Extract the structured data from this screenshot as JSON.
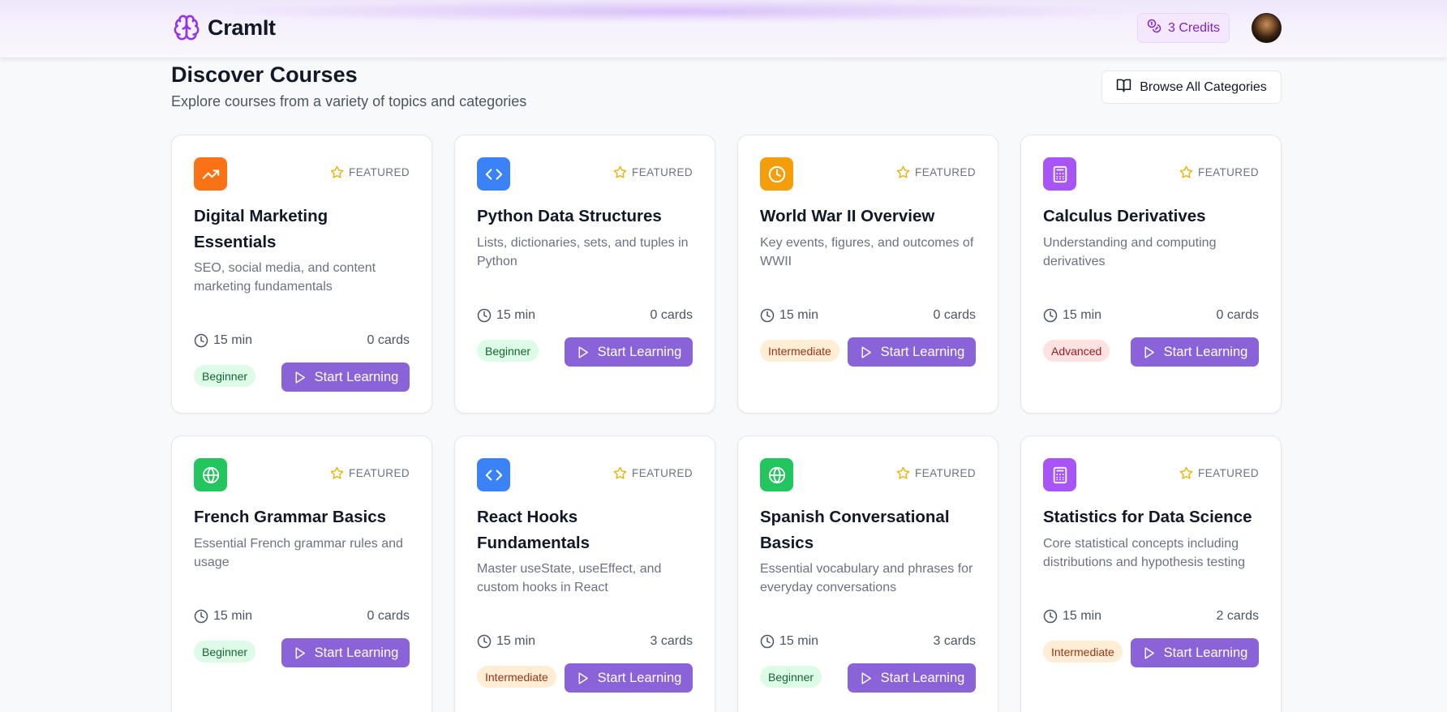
{
  "header": {
    "brand": "CramIt",
    "credits": "3 Credits"
  },
  "page": {
    "title": "Discover Courses",
    "subtitle": "Explore courses from a variety of topics and categories",
    "browse_label": "Browse All Categories"
  },
  "colors": {
    "accent": "#8b63d9",
    "icon_orange_dark": "#f97316",
    "icon_blue": "#3b82f6",
    "icon_amber": "#f59e0b",
    "icon_purple": "#a855f7",
    "icon_green": "#22c55e"
  },
  "courses": [
    {
      "icon": "trending-up-icon",
      "featured": "FEATURED",
      "title": "Digital Marketing Essentials",
      "description": "SEO, social media, and content marketing fundamentals",
      "duration": "15 min",
      "cards": "0 cards",
      "level": "Beginner",
      "cta": "Start Learning"
    },
    {
      "icon": "code-icon",
      "featured": "FEATURED",
      "title": "Python Data Structures",
      "description": "Lists, dictionaries, sets, and tuples in Python",
      "duration": "15 min",
      "cards": "0 cards",
      "level": "Beginner",
      "cta": "Start Learning"
    },
    {
      "icon": "clock-icon",
      "featured": "FEATURED",
      "title": "World War II Overview",
      "description": "Key events, figures, and outcomes of WWII",
      "duration": "15 min",
      "cards": "0 cards",
      "level": "Intermediate",
      "cta": "Start Learning"
    },
    {
      "icon": "calculator-icon",
      "featured": "FEATURED",
      "title": "Calculus Derivatives",
      "description": "Understanding and computing derivatives",
      "duration": "15 min",
      "cards": "0 cards",
      "level": "Advanced",
      "cta": "Start Learning"
    },
    {
      "icon": "globe-icon",
      "featured": "FEATURED",
      "title": "French Grammar Basics",
      "description": "Essential French grammar rules and usage",
      "duration": "15 min",
      "cards": "0 cards",
      "level": "Beginner",
      "cta": "Start Learning"
    },
    {
      "icon": "code-icon",
      "featured": "FEATURED",
      "title": "React Hooks Fundamentals",
      "description": "Master useState, useEffect, and custom hooks in React",
      "duration": "15 min",
      "cards": "3 cards",
      "level": "Intermediate",
      "cta": "Start Learning"
    },
    {
      "icon": "globe-icon",
      "featured": "FEATURED",
      "title": "Spanish Conversational Basics",
      "description": "Essential vocabulary and phrases for everyday conversations",
      "duration": "15 min",
      "cards": "3 cards",
      "level": "Beginner",
      "cta": "Start Learning"
    },
    {
      "icon": "calculator-icon",
      "featured": "FEATURED",
      "title": "Statistics for Data Science",
      "description": "Core statistical concepts including distributions and hypothesis testing",
      "duration": "15 min",
      "cards": "2 cards",
      "level": "Intermediate",
      "cta": "Start Learning"
    }
  ]
}
